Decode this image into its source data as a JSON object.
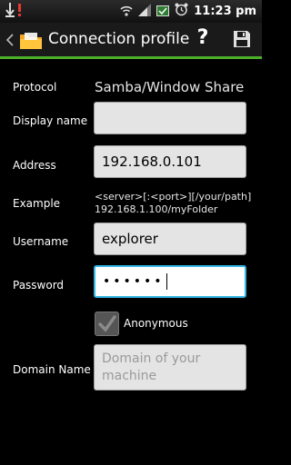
{
  "status_bar": {
    "time": "11:23 pm",
    "icons": [
      "usb-debug-icon",
      "warning-icon",
      "wifi-icon",
      "signal-icon",
      "battery-icon",
      "alarm-icon"
    ]
  },
  "action_bar": {
    "title": "Connection profile",
    "icons": [
      "back-icon",
      "folder-icon",
      "help-icon",
      "save-icon"
    ],
    "help_glyph": "?",
    "accent_color": "#4caf2a"
  },
  "form": {
    "protocol_label": "Protocol",
    "protocol_value": "Samba/Window Share",
    "display_name_label": "Display name",
    "display_name_value": "",
    "address_label": "Address",
    "address_value": "192.168.0.101",
    "example_label": "Example",
    "example_line1": "<server>[:<port>][/your/path]",
    "example_line2": "192.168.1.100/myFolder",
    "username_label": "Username",
    "username_value": "explorer",
    "password_label": "Password",
    "password_mask": "••••••",
    "anonymous_label": "Anonymous",
    "anonymous_checked": true,
    "domain_label": "Domain Name",
    "domain_placeholder": "Domain of your machine",
    "focus_color": "#33b5e5"
  }
}
